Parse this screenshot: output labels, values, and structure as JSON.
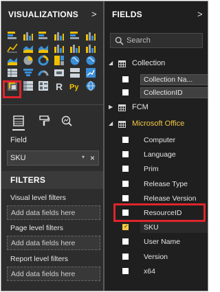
{
  "visualizations": {
    "title": "VISUALIZATIONS",
    "chevron": ">",
    "icons": [
      "stacked-bar-chart-icon",
      "stacked-column-chart-icon",
      "clustered-bar-chart-icon",
      "clustered-column-chart-icon",
      "100-percent-bar-chart-icon",
      "100-percent-column-chart-icon",
      "line-chart-icon",
      "area-chart-icon",
      "stacked-area-chart-icon",
      "line-and-column-chart-icon",
      "line-and-clustered-column-chart-icon",
      "waterfall-chart-icon",
      "scatter-chart-icon",
      "pie-chart-icon",
      "donut-chart-icon",
      "treemap-icon",
      "map-icon",
      "filled-map-icon",
      "table-icon",
      "funnel-chart-icon",
      "gauge-icon",
      "card-icon",
      "multi-row-card-icon",
      "kpi-icon",
      "custom-visual-icon",
      "matrix-icon",
      "slicer-icon",
      "r-script-visual-icon",
      "python-visual-icon",
      "globe-icon"
    ],
    "selected_index": 24
  },
  "build_tabs": [
    "fields-tab-icon",
    "format-paint-roller-icon",
    "analytics-magnifier-icon"
  ],
  "field_well": {
    "label": "Field",
    "value": "SKU",
    "caret": "▾",
    "remove": "×"
  },
  "filters": {
    "title": "FILTERS",
    "groups": [
      {
        "label": "Visual level filters",
        "placeholder": "Add data fields here"
      },
      {
        "label": "Page level filters",
        "placeholder": "Add data fields here"
      },
      {
        "label": "Report level filters",
        "placeholder": "Add data fields here"
      }
    ]
  },
  "fields_pane": {
    "title": "FIELDS",
    "chevron": ">",
    "search_placeholder": "Search",
    "tables": [
      {
        "name": "Collection",
        "expanded": true,
        "chevron": "◢",
        "fields": [
          "Collection Na...",
          "CollectionID"
        ]
      },
      {
        "name": "FCM",
        "expanded": false,
        "chevron": "▶",
        "fields": []
      },
      {
        "name": "Microsoft Office",
        "expanded": true,
        "active": true,
        "chevron": "◢",
        "fields": [
          "Computer",
          "Language",
          "Prim",
          "Release Type",
          "Release Version",
          "ResourceID",
          "SKU",
          "User Name",
          "Version",
          "x64"
        ]
      }
    ],
    "checked_field": "SKU",
    "check_mark": "✓"
  },
  "colors": {
    "highlight_red": "#e0252c",
    "active_yellow": "#f2c744",
    "pane_bg": "#2d2d2d",
    "fields_bg": "#1f1f1f"
  }
}
